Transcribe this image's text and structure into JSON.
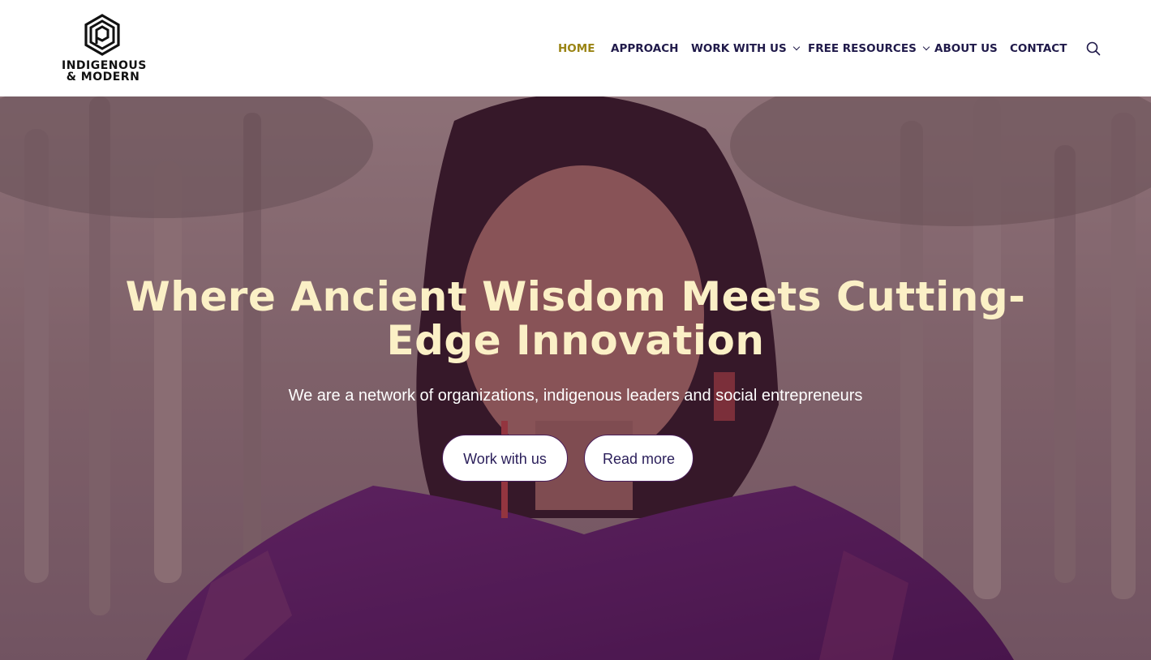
{
  "brand": {
    "logo_line1": "INDIGENOUS",
    "logo_line2": "& MODERN",
    "icon": "hexagon-logo-icon"
  },
  "nav": {
    "items": [
      {
        "label": "HOME",
        "active": true,
        "has_dropdown": false
      },
      {
        "label": "APPROACH",
        "active": false,
        "has_dropdown": false
      },
      {
        "label": "WORK WITH US",
        "active": false,
        "has_dropdown": true
      },
      {
        "label": "FREE RESOURCES",
        "active": false,
        "has_dropdown": true
      },
      {
        "label": "ABOUT US",
        "active": false,
        "has_dropdown": false
      },
      {
        "label": "CONTACT",
        "active": false,
        "has_dropdown": false
      }
    ],
    "search_icon": "search-icon"
  },
  "hero": {
    "title": "Where Ancient Wisdom Meets Cutting-Edge Innovation",
    "subtitle": "We are a network of organizations, indigenous leaders and social entrepreneurs",
    "primary_button": "Work with us",
    "secondary_button": "Read more"
  },
  "colors": {
    "nav_text": "#201a4a",
    "nav_active": "#9a8414",
    "hero_title": "#fbf0c6",
    "button_text": "#2a1e5a"
  }
}
